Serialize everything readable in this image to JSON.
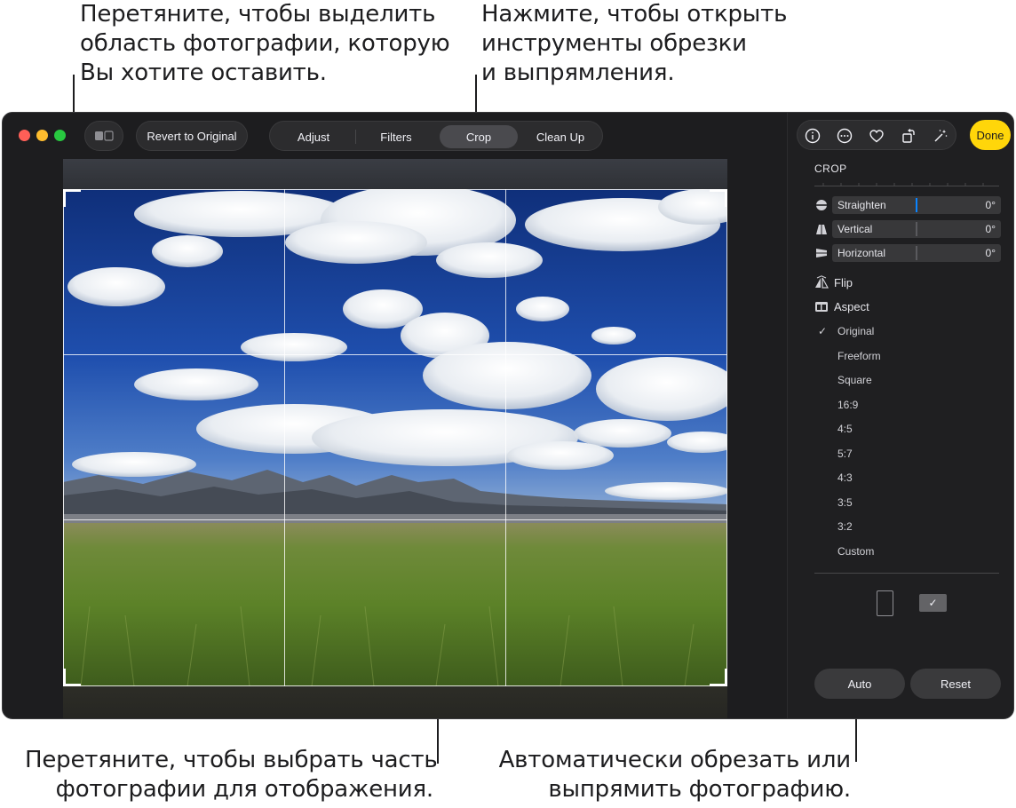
{
  "callouts": {
    "crop_handle": [
      "Перетяните, чтобы выделить",
      "область фотографии, которую",
      "Вы хотите оставить."
    ],
    "crop_tab": [
      "Нажмите, чтобы открыть",
      "инструменты обрезки",
      "и выпрямления."
    ],
    "drag_photo": [
      "Перетяните, чтобы выбрать часть",
      "фотографии для отображения."
    ],
    "auto": [
      "Автоматически обрезать или",
      "выпрямить фотографию."
    ]
  },
  "toolbar": {
    "revert_label": "Revert to Original",
    "tabs": [
      {
        "label": "Adjust",
        "active": false
      },
      {
        "label": "Filters",
        "active": false
      },
      {
        "label": "Crop",
        "active": true
      },
      {
        "label": "Clean Up",
        "active": false
      }
    ],
    "done_label": "Done",
    "icons": [
      "info-icon",
      "more-icon",
      "heart-icon",
      "rotate-icon",
      "magic-wand-icon"
    ],
    "traffic_colors": [
      "#ff5f57",
      "#febc2e",
      "#28c840"
    ],
    "accent": "#ffd60a"
  },
  "sidebar": {
    "section_title": "CROP",
    "sliders": [
      {
        "label": "Straighten",
        "value": "0°",
        "icon": "straighten-icon"
      },
      {
        "label": "Vertical",
        "value": "0°",
        "icon": "vertical-icon"
      },
      {
        "label": "Horizontal",
        "value": "0°",
        "icon": "horizontal-icon"
      }
    ],
    "flip_label": "Flip",
    "aspect_label": "Aspect",
    "aspect_options": [
      "Original",
      "Freeform",
      "Square",
      "16:9",
      "4:5",
      "5:7",
      "4:3",
      "3:5",
      "3:2",
      "Custom"
    ],
    "aspect_selected": "Original",
    "check_mark": "✓",
    "auto_label": "Auto",
    "reset_label": "Reset"
  }
}
